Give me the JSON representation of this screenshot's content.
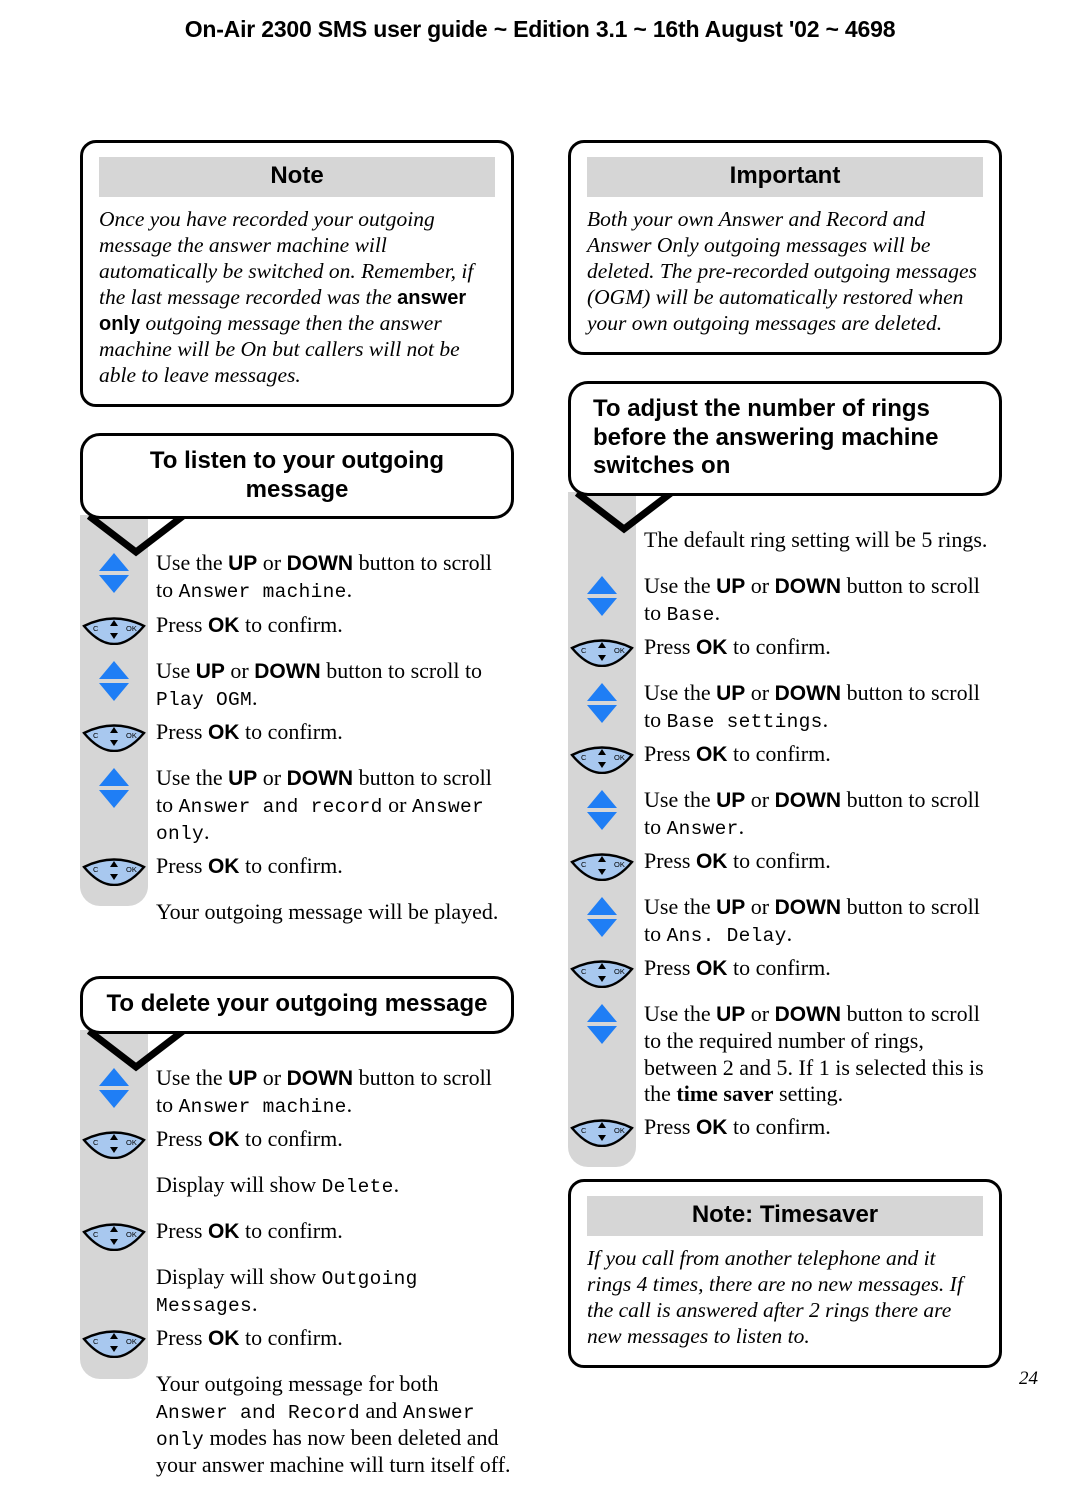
{
  "header": {
    "text": "On-Air 2300 SMS user guide ~ Edition 3.1 ~ 16th August '02 ~ 4698"
  },
  "page_number": "24",
  "colors": {
    "rail_gray": "#d6d6d6",
    "title_bar_gray": "#d6d6d6",
    "arrow_blue": "#1f7ef5",
    "button_blue": "#a8c8ef",
    "outline": "#000000"
  },
  "icons": {
    "up_down": "up-down-arrows-icon",
    "nav_button": "nav-ok-button-icon",
    "callout_tail": "callout-tail-icon"
  },
  "left_column": {
    "note_box": {
      "title": "Note",
      "body_pre": "Once you have recorded your outgoing message the answer machine will automatically be switched on. Remember, if the last message recorded was the ",
      "body_bold": "answer only",
      "body_post": " outgoing message then the answer machine will be On but callers will not be able to leave messages."
    },
    "procedure_listen": {
      "title": "To listen to your outgoing message",
      "steps": [
        {
          "icon": "up-down-arrows-icon",
          "text_pre": "Use the ",
          "b1": "UP",
          "mid1": " or ",
          "b2": "DOWN",
          "mid2": " button to scroll to ",
          "lcd": "Answer machine",
          "text_post": "."
        },
        {
          "icon": "nav-ok-button-icon",
          "text_pre": "Press ",
          "b1": "OK",
          "mid1": " to confirm.",
          "b2": "",
          "mid2": "",
          "lcd": "",
          "text_post": ""
        },
        {
          "icon": "up-down-arrows-icon",
          "text_pre": "Use ",
          "b1": "UP",
          "mid1": " or ",
          "b2": "DOWN",
          "mid2": " button to scroll to ",
          "lcd": "Play OGM",
          "text_post": "."
        },
        {
          "icon": "nav-ok-button-icon",
          "text_pre": "Press ",
          "b1": "OK",
          "mid1": " to confirm.",
          "b2": "",
          "mid2": "",
          "lcd": "",
          "text_post": ""
        },
        {
          "icon": "up-down-arrows-icon",
          "text_pre": "Use the ",
          "b1": "UP",
          "mid1": " or ",
          "b2": "DOWN",
          "mid2": " button to scroll to ",
          "lcd": "Answer and record",
          "text_mid3": " or ",
          "lcd2": "Answer only",
          "text_post": "."
        },
        {
          "icon": "nav-ok-button-icon",
          "text_pre": "Press ",
          "b1": "OK",
          "mid1": " to confirm.",
          "b2": "",
          "mid2": "",
          "lcd": "",
          "text_post": ""
        },
        {
          "icon": "none",
          "text_pre": "Your outgoing message will be played.",
          "b1": "",
          "mid1": "",
          "b2": "",
          "mid2": "",
          "lcd": "",
          "text_post": ""
        }
      ]
    },
    "procedure_delete": {
      "title": "To delete your outgoing message",
      "steps": [
        {
          "icon": "up-down-arrows-icon",
          "text_pre": "Use the ",
          "b1": "UP",
          "mid1": " or ",
          "b2": "DOWN",
          "mid2": " button to scroll to ",
          "lcd": "Answer machine",
          "text_post": "."
        },
        {
          "icon": "nav-ok-button-icon",
          "text_pre": "Press ",
          "b1": "OK",
          "mid1": " to confirm.",
          "b2": "",
          "mid2": "",
          "lcd": "",
          "text_post": ""
        },
        {
          "icon": "none",
          "text_pre": "Display will show ",
          "b1": "",
          "mid1": "",
          "b2": "",
          "mid2": "",
          "lcd": "Delete",
          "text_post": "."
        },
        {
          "icon": "nav-ok-button-icon",
          "text_pre": "Press ",
          "b1": "OK",
          "mid1": " to confirm.",
          "b2": "",
          "mid2": "",
          "lcd": "",
          "text_post": ""
        },
        {
          "icon": "none",
          "text_pre": "Display will show ",
          "b1": "",
          "mid1": "",
          "b2": "",
          "mid2": "",
          "lcd": "Outgoing Messages",
          "text_post": "."
        },
        {
          "icon": "nav-ok-button-icon",
          "text_pre": "Press ",
          "b1": "OK",
          "mid1": " to confirm.",
          "b2": "",
          "mid2": "",
          "lcd": "",
          "text_post": ""
        },
        {
          "icon": "none",
          "text_pre": "Your outgoing message for both ",
          "b1": "",
          "mid1": "",
          "b2": "",
          "mid2": "",
          "lcd": "Answer and Record",
          "text_mid3": " and ",
          "lcd2": "Answer only",
          "text_post": " modes has now been deleted and your answer machine will turn itself off."
        }
      ]
    }
  },
  "right_column": {
    "important_box": {
      "title": "Important",
      "body": "Both your own Answer and Record and Answer Only outgoing messages will be deleted. The pre-recorded outgoing messages (OGM) will be automatically restored when your own outgoing messages are deleted."
    },
    "procedure_rings": {
      "title": "To adjust the number of rings before the answering machine switches on",
      "steps": [
        {
          "icon": "none",
          "text_pre": "The default ring setting will be 5 rings.",
          "b1": "",
          "mid1": "",
          "b2": "",
          "mid2": "",
          "lcd": "",
          "text_post": ""
        },
        {
          "icon": "up-down-arrows-icon",
          "text_pre": "Use the ",
          "b1": "UP",
          "mid1": " or ",
          "b2": "DOWN",
          "mid2": " button to scroll to ",
          "lcd": "Base",
          "text_post": "."
        },
        {
          "icon": "nav-ok-button-icon",
          "text_pre": "Press ",
          "b1": "OK",
          "mid1": " to confirm.",
          "b2": "",
          "mid2": "",
          "lcd": "",
          "text_post": ""
        },
        {
          "icon": "up-down-arrows-icon",
          "text_pre": "Use the ",
          "b1": "UP",
          "mid1": " or ",
          "b2": "DOWN",
          "mid2": " button to scroll to ",
          "lcd": "Base settings",
          "text_post": "."
        },
        {
          "icon": "nav-ok-button-icon",
          "text_pre": "Press ",
          "b1": "OK",
          "mid1": " to confirm.",
          "b2": "",
          "mid2": "",
          "lcd": "",
          "text_post": ""
        },
        {
          "icon": "up-down-arrows-icon",
          "text_pre": "Use the ",
          "b1": "UP",
          "mid1": " or ",
          "b2": "DOWN",
          "mid2": " button to scroll to ",
          "lcd": "Answer",
          "text_post": "."
        },
        {
          "icon": "nav-ok-button-icon",
          "text_pre": "Press ",
          "b1": "OK",
          "mid1": " to confirm.",
          "b2": "",
          "mid2": "",
          "lcd": "",
          "text_post": ""
        },
        {
          "icon": "up-down-arrows-icon",
          "text_pre": "Use the ",
          "b1": "UP",
          "mid1": " or ",
          "b2": "DOWN",
          "mid2": " button to scroll to ",
          "lcd": "Ans. Delay",
          "text_post": "."
        },
        {
          "icon": "nav-ok-button-icon",
          "text_pre": "Press ",
          "b1": "OK",
          "mid1": " to confirm.",
          "b2": "",
          "mid2": "",
          "lcd": "",
          "text_post": ""
        },
        {
          "icon": "up-down-arrows-icon",
          "text_pre": "Use the ",
          "b1": "UP",
          "mid1": " or ",
          "b2": "DOWN",
          "mid2": " button to scroll to the required number of rings, between 2 and 5. If 1 is selected this is the ",
          "serif_bold": "time saver",
          "mid3": " setting.",
          "lcd": "",
          "text_post": ""
        },
        {
          "icon": "nav-ok-button-icon",
          "text_pre": "Press ",
          "b1": "OK",
          "mid1": " to confirm.",
          "b2": "",
          "mid2": "",
          "lcd": "",
          "text_post": ""
        }
      ]
    },
    "timesaver_box": {
      "title": "Note: Timesaver",
      "body": "If you call from another telephone and it rings 4 times, there are no new messages. If the call is answered after 2 rings there are new messages to listen to."
    }
  }
}
